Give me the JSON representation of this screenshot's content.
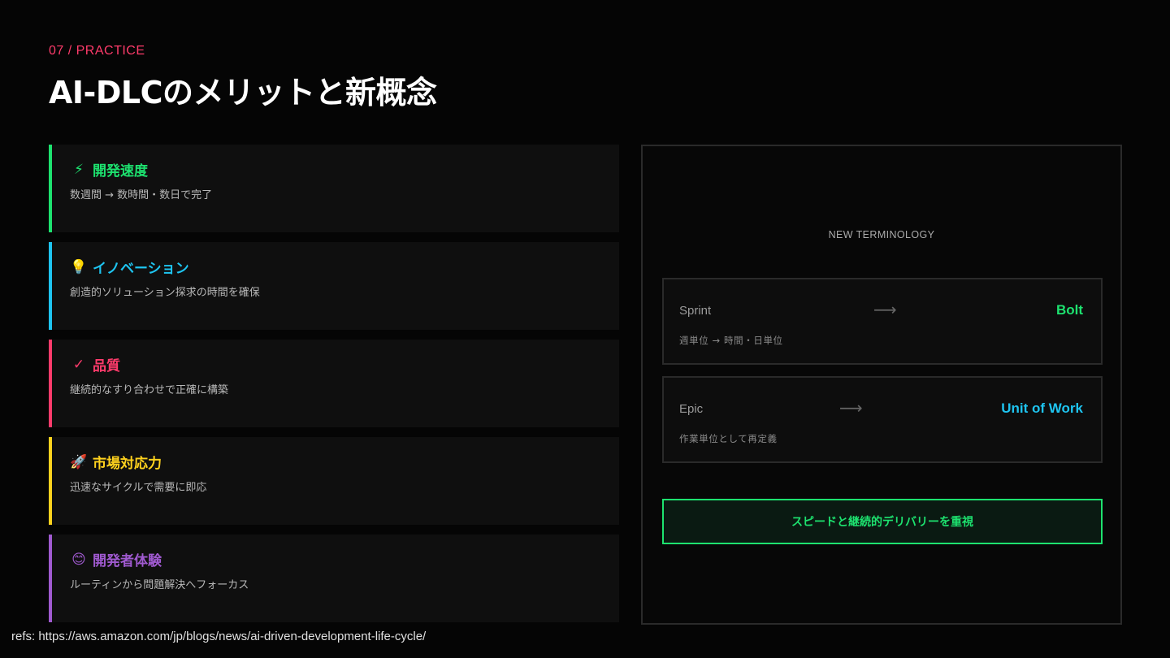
{
  "header": {
    "kicker": "07 / PRACTICE",
    "title": "AI-DLCのメリットと新概念"
  },
  "benefits": [
    {
      "emoji": "⚡",
      "icon": "lightning-icon",
      "title": "開発速度",
      "desc": "数週間 → 数時間・数日で完了",
      "color": "#1de26f"
    },
    {
      "emoji": "💡",
      "icon": "lightbulb-icon",
      "title": "イノベーション",
      "desc": "創造的ソリューション探求の時間を確保",
      "color": "#1ec4f0"
    },
    {
      "emoji": "✓",
      "icon": "checkmark-icon",
      "title": "品質",
      "desc": "継続的なすり合わせで正確に構築",
      "color": "#ff3b6b"
    },
    {
      "emoji": "🚀",
      "icon": "rocket-icon",
      "title": "市場対応力",
      "desc": "迅速なサイクルで需要に即応",
      "color": "#ffd21e"
    },
    {
      "emoji": "😊",
      "icon": "smile-icon",
      "title": "開発者体験",
      "desc": "ルーティンから問題解決へフォーカス",
      "color": "#a05ad0"
    }
  ],
  "terminology": {
    "title": "NEW TERMINOLOGY",
    "items": [
      {
        "from": "Sprint",
        "arrow": "⟶",
        "to": "Bolt",
        "to_color": "#1de26f",
        "note": "週単位 → 時間・日単位"
      },
      {
        "from": "Epic",
        "arrow": "⟶",
        "to": "Unit of Work",
        "to_color": "#1ec4f0",
        "note": "作業単位として再定義"
      }
    ],
    "cta": "スピードと継続的デリバリーを重視"
  },
  "refs": "refs: https://aws.amazon.com/jp/blogs/news/ai-driven-development-life-cycle/"
}
